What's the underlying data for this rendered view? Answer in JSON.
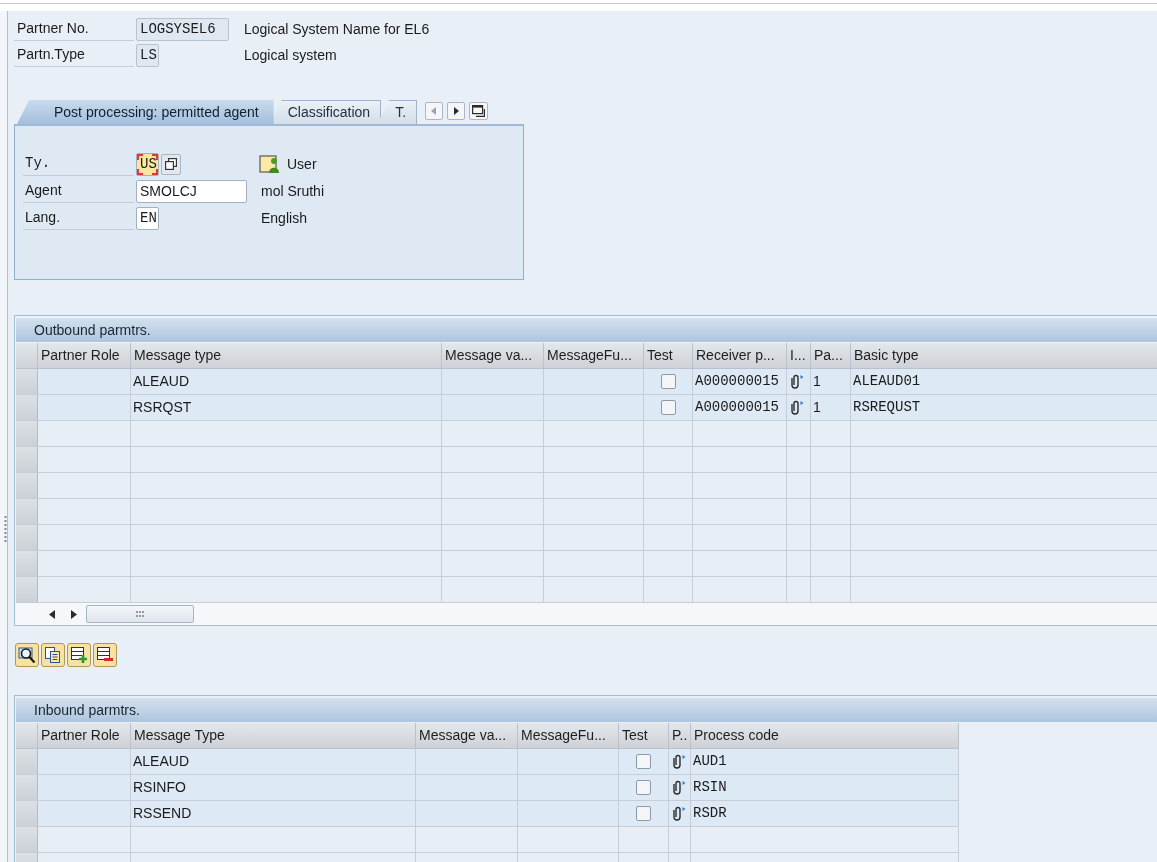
{
  "header": {
    "fields": [
      {
        "label": "Partner No.",
        "value": "LOGSYSEL6",
        "editable": false,
        "description": "Logical System Name for EL6"
      },
      {
        "label": "Partn.Type",
        "value": "LS",
        "editable": false,
        "description": "Logical system"
      }
    ]
  },
  "tabs": [
    {
      "label": "Post processing: permitted agent",
      "selected": true
    },
    {
      "label": "Classification",
      "selected": false
    },
    {
      "label": "T.",
      "selected": false
    }
  ],
  "agent": {
    "fields": [
      {
        "kind": "type",
        "label": "Ty.",
        "value": "US",
        "editable": true,
        "focused": true,
        "description": "User"
      },
      {
        "kind": "agent",
        "label": "Agent",
        "value": "SMOLCJ",
        "editable": true,
        "focused": false,
        "description": "mol Sruthi"
      },
      {
        "kind": "language",
        "label": "Lang.",
        "value": "EN",
        "editable": true,
        "focused": false,
        "description": "English"
      }
    ]
  },
  "outbound": {
    "title": "Outbound parmtrs.",
    "columns": [
      {
        "label": "Partner Role"
      },
      {
        "label": "Message type"
      },
      {
        "label": "Message va..."
      },
      {
        "label": "MessageFu..."
      },
      {
        "label": "Test"
      },
      {
        "label": "Receiver p..."
      },
      {
        "label": "I..."
      },
      {
        "label": "Pa..."
      },
      {
        "label": "Basic type"
      }
    ],
    "rows": [
      {
        "message_type": "ALEAUD",
        "test": false,
        "receiver_p": "A000000015",
        "pa": "1",
        "basic_type": "ALEAUD01"
      },
      {
        "message_type": "RSRQST",
        "test": false,
        "receiver_p": "A000000015",
        "pa": "1",
        "basic_type": "RSREQUST"
      }
    ]
  },
  "inbound": {
    "title": "Inbound parmtrs.",
    "columns": [
      {
        "label": "Partner Role"
      },
      {
        "label": "Message Type"
      },
      {
        "label": "Message va..."
      },
      {
        "label": "MessageFu..."
      },
      {
        "label": "Test"
      },
      {
        "label": "P.."
      },
      {
        "label": "Process code"
      }
    ],
    "rows": [
      {
        "message_type": "ALEAUD",
        "test": false,
        "process_code": "AUD1"
      },
      {
        "message_type": "RSINFO",
        "test": false,
        "process_code": "RSIN"
      },
      {
        "message_type": "RSSEND",
        "test": false,
        "process_code": "RSDR"
      }
    ]
  }
}
